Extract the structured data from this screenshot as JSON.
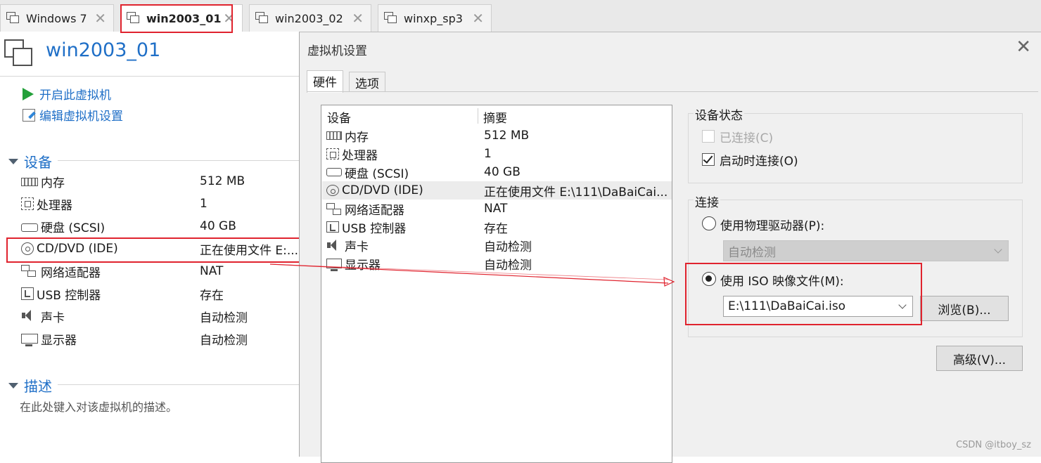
{
  "tabs": [
    {
      "label": "Windows 7",
      "active": false
    },
    {
      "label": "win2003_01",
      "active": true
    },
    {
      "label": "win2003_02",
      "active": false
    },
    {
      "label": "winxp_sp3",
      "active": false
    }
  ],
  "vm": {
    "title": "win2003_01",
    "actions": {
      "power_on": "开启此虚拟机",
      "edit_settings": "编辑虚拟机设置"
    },
    "devices_heading": "设备",
    "devices": [
      {
        "name": "内存",
        "value": "512 MB",
        "icon": "memory-icon"
      },
      {
        "name": "处理器",
        "value": "1",
        "icon": "processor-icon"
      },
      {
        "name": "硬盘 (SCSI)",
        "value": "40 GB",
        "icon": "hard-disk-icon"
      },
      {
        "name": "CD/DVD (IDE)",
        "value": "正在使用文件 E:...",
        "icon": "cd-dvd-icon"
      },
      {
        "name": "网络适配器",
        "value": "NAT",
        "icon": "network-adapter-icon"
      },
      {
        "name": "USB 控制器",
        "value": "存在",
        "icon": "usb-icon"
      },
      {
        "name": "声卡",
        "value": "自动检测",
        "icon": "sound-card-icon"
      },
      {
        "name": "显示器",
        "value": "自动检测",
        "icon": "display-icon"
      }
    ],
    "description_heading": "描述",
    "description_placeholder": "在此处键入对该虚拟机的描述。"
  },
  "dialog": {
    "title": "虚拟机设置",
    "tabs": [
      "硬件",
      "选项"
    ],
    "list_headers": {
      "device": "设备",
      "summary": "摘要"
    },
    "devices": [
      {
        "name": "内存",
        "summary": "512 MB"
      },
      {
        "name": "处理器",
        "summary": "1"
      },
      {
        "name": "硬盘 (SCSI)",
        "summary": "40 GB"
      },
      {
        "name": "CD/DVD (IDE)",
        "summary": "正在使用文件 E:\\111\\DaBaiCai..."
      },
      {
        "name": "网络适配器",
        "summary": "NAT"
      },
      {
        "name": "USB 控制器",
        "summary": "存在"
      },
      {
        "name": "声卡",
        "summary": "自动检测"
      },
      {
        "name": "显示器",
        "summary": "自动检测"
      }
    ],
    "device_status": {
      "label": "设备状态",
      "connected": "已连接(C)",
      "connect_at_power_on": "启动时连接(O)"
    },
    "connection": {
      "label": "连接",
      "physical_drive": "使用物理驱动器(P):",
      "physical_drive_value": "自动检测",
      "iso_image": "使用 ISO 映像文件(M):",
      "iso_path": "E:\\111\\DaBaiCai.iso",
      "browse": "浏览(B)..."
    },
    "advanced": "高级(V)..."
  },
  "watermark": "CSDN @itboy_sz",
  "colors": {
    "accent": "#1f6fc7",
    "highlight": "#e0232e",
    "play": "#23a03a"
  }
}
